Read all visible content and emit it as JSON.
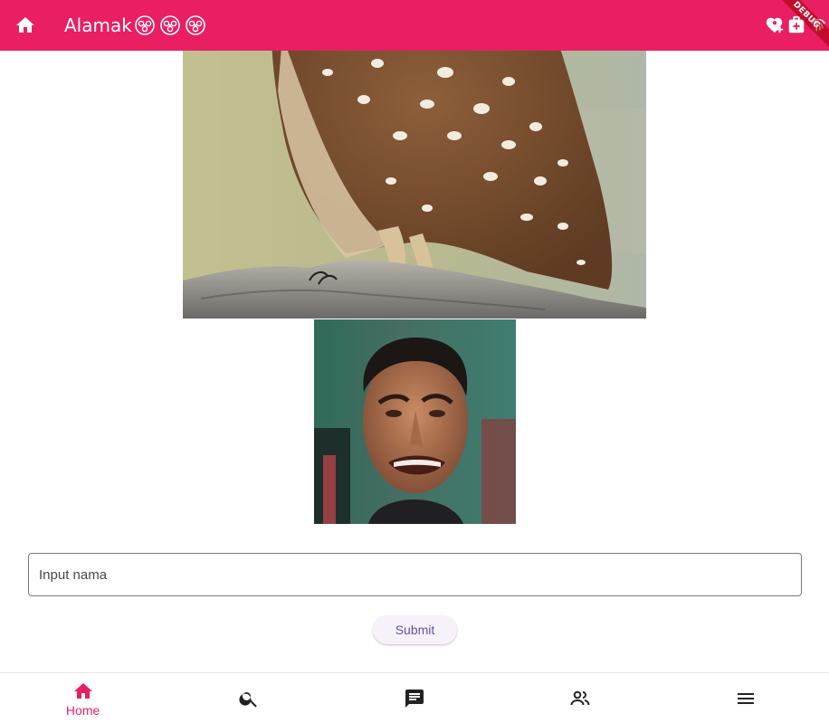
{
  "appbar": {
    "title": "Alamak",
    "title_emojis": [
      "biohazard-face-icon",
      "biohazard-face-icon",
      "biohazard-face-icon"
    ],
    "leading_icon": "home-icon",
    "actions": [
      "heart-plus-icon",
      "medical-plus-icon",
      "fingerprint-icon"
    ],
    "background": "#e91e63"
  },
  "debug_banner": "DEBUG",
  "images": [
    {
      "name": "owl-image",
      "description_icon": "owl-photo"
    },
    {
      "name": "crying-face-image",
      "description_icon": "face-photo"
    }
  ],
  "form": {
    "name_input": {
      "placeholder": "Input nama",
      "value": ""
    },
    "submit_label": "Submit"
  },
  "bottom_nav": {
    "items": [
      {
        "icon": "home-icon",
        "label": "Home",
        "active": true
      },
      {
        "icon": "search-icon",
        "label": "",
        "active": false
      },
      {
        "icon": "chat-icon",
        "label": "",
        "active": false
      },
      {
        "icon": "people-icon",
        "label": "",
        "active": false
      },
      {
        "icon": "menu-icon",
        "label": "",
        "active": false
      }
    ],
    "accent": "#e91e63"
  }
}
